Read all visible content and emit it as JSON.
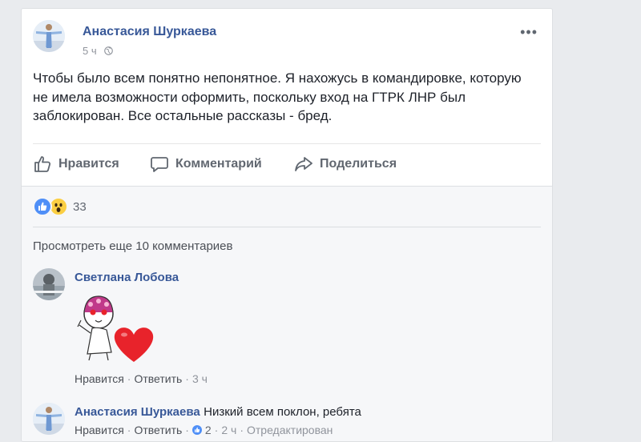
{
  "post": {
    "author": "Анастасия Шуркаева",
    "time": "5 ч",
    "text": "Чтобы было всем понятно непонятное. Я нахожусь в командировке, которую не имела возможности оформить, поскольку вход на ГТРК ЛНР был заблокирован. Все остальные рассказы - бред.",
    "more_label": "•••"
  },
  "actions": {
    "like": "Нравится",
    "comment": "Комментарий",
    "share": "Поделиться"
  },
  "reactions": {
    "icons": [
      "like-icon",
      "wow-icon"
    ],
    "count": "33"
  },
  "view_more": "Просмотреть еще 10 комментариев",
  "comments": [
    {
      "author": "Светлана Лобова",
      "text": "",
      "sticker": "heart-sticker",
      "like": "Нравится",
      "reply": "Ответить",
      "time": "3 ч"
    },
    {
      "author": "Анастасия Шуркаева",
      "text": "Низкий всем поклон, ребята",
      "like": "Нравится",
      "reply": "Ответить",
      "likes": "2",
      "time": "2 ч",
      "edited": "Отредактирован"
    }
  ],
  "colors": {
    "link": "#385898",
    "like_blue": "#4f8ff7",
    "heart_red": "#e8232b",
    "background": "#e9ebee"
  }
}
